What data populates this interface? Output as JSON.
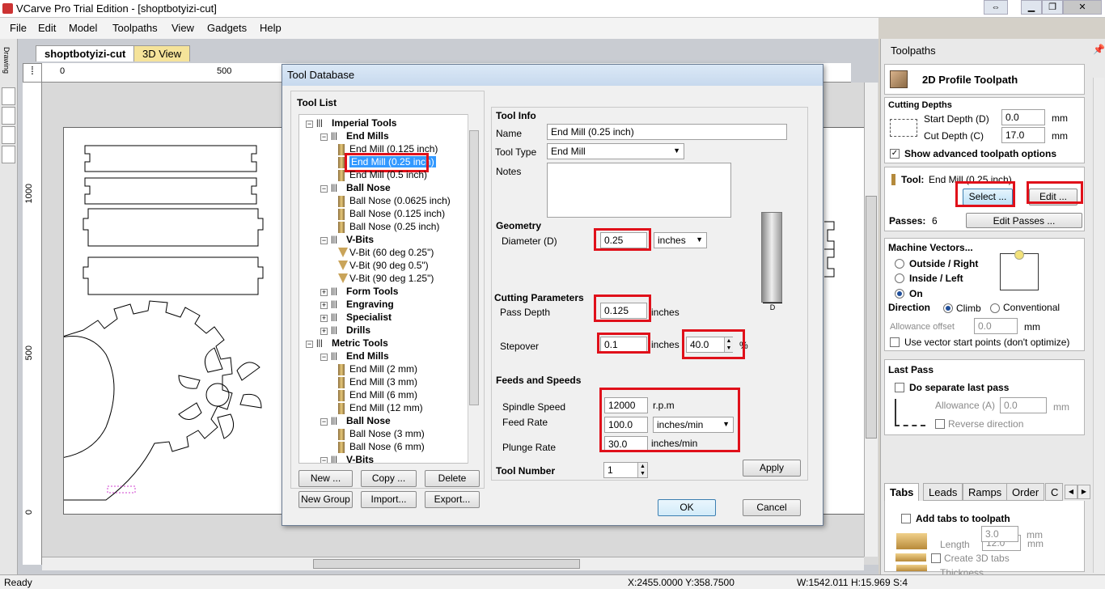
{
  "window": {
    "title": "VCarve Pro Trial Edition - [shoptbotyizi-cut]"
  },
  "menu": [
    "File",
    "Edit",
    "Model",
    "Toolpaths",
    "View",
    "Gadgets",
    "Help"
  ],
  "doc_tabs": {
    "active": "shoptbotyizi-cut",
    "other": "3D View"
  },
  "left_toolbar": {
    "label": "Drawing"
  },
  "rulers": {
    "h_ticks": [
      "0",
      "500"
    ],
    "v_ticks": [
      "1000",
      "500",
      "0"
    ]
  },
  "dialog": {
    "title": "Tool Database",
    "tool_list_label": "Tool List",
    "tree": [
      {
        "label": "Imperial Tools",
        "level": 0,
        "group": true,
        "sign": "−"
      },
      {
        "label": "End Mills",
        "level": 1,
        "group": true,
        "sign": "−"
      },
      {
        "label": "End Mill (0.125 inch)",
        "level": 2,
        "icon": "end-mill-icon"
      },
      {
        "label": "End Mill (0.25 inch)",
        "level": 2,
        "icon": "end-mill-icon",
        "selected": true
      },
      {
        "label": "End Mill (0.5 inch)",
        "level": 2,
        "icon": "end-mill-icon"
      },
      {
        "label": "Ball Nose",
        "level": 1,
        "group": true,
        "sign": "−"
      },
      {
        "label": "Ball Nose (0.0625 inch)",
        "level": 2,
        "icon": "ball-nose-icon"
      },
      {
        "label": "Ball Nose (0.125 inch)",
        "level": 2,
        "icon": "ball-nose-icon"
      },
      {
        "label": "Ball Nose (0.25 inch)",
        "level": 2,
        "icon": "ball-nose-icon"
      },
      {
        "label": "V-Bits",
        "level": 1,
        "group": true,
        "sign": "−"
      },
      {
        "label": "V-Bit (60 deg 0.25\")",
        "level": 2,
        "icon": "v-bit-icon"
      },
      {
        "label": "V-Bit (90 deg 0.5\")",
        "level": 2,
        "icon": "v-bit-icon"
      },
      {
        "label": "V-Bit (90 deg 1.25\")",
        "level": 2,
        "icon": "v-bit-icon"
      },
      {
        "label": "Form Tools",
        "level": 1,
        "group": true,
        "sign": "+"
      },
      {
        "label": "Engraving",
        "level": 1,
        "group": true,
        "sign": "+"
      },
      {
        "label": "Specialist",
        "level": 1,
        "group": true,
        "sign": "+"
      },
      {
        "label": "Drills",
        "level": 1,
        "group": true,
        "sign": "+"
      },
      {
        "label": "Metric Tools",
        "level": 0,
        "group": true,
        "sign": "−"
      },
      {
        "label": "End Mills",
        "level": 1,
        "group": true,
        "sign": "−"
      },
      {
        "label": "End Mill (2 mm)",
        "level": 2,
        "icon": "end-mill-icon"
      },
      {
        "label": "End Mill (3 mm)",
        "level": 2,
        "icon": "end-mill-icon"
      },
      {
        "label": "End Mill (6 mm)",
        "level": 2,
        "icon": "end-mill-icon"
      },
      {
        "label": "End Mill (12 mm)",
        "level": 2,
        "icon": "end-mill-icon"
      },
      {
        "label": "Ball Nose",
        "level": 1,
        "group": true,
        "sign": "−"
      },
      {
        "label": "Ball Nose (3 mm)",
        "level": 2,
        "icon": "ball-nose-icon"
      },
      {
        "label": "Ball Nose (6 mm)",
        "level": 2,
        "icon": "ball-nose-icon"
      },
      {
        "label": "V-Bits",
        "level": 1,
        "group": true,
        "sign": "−"
      }
    ],
    "buttons": {
      "new": "New ...",
      "copy": "Copy ...",
      "delete": "Delete",
      "new_group": "New Group",
      "import": "Import...",
      "export": "Export...",
      "apply": "Apply",
      "ok": "OK",
      "cancel": "Cancel"
    },
    "tool_info": {
      "heading": "Tool Info",
      "name_label": "Name",
      "name_value": "End Mill (0.25 inch)",
      "type_label": "Tool Type",
      "type_value": "End Mill",
      "notes_label": "Notes"
    },
    "geometry": {
      "heading": "Geometry",
      "diameter_label": "Diameter (D)",
      "diameter_value": "0.25",
      "units": "inches",
      "diagram_label": "D"
    },
    "cutting": {
      "heading": "Cutting Parameters",
      "pass_depth_label": "Pass Depth",
      "pass_depth_value": "0.125",
      "pass_depth_units": "inches",
      "stepover_label": "Stepover",
      "stepover_value": "0.1",
      "stepover_units": "inches",
      "stepover_pct": "40.0",
      "pct": "%"
    },
    "feeds": {
      "heading": "Feeds and Speeds",
      "spindle_label": "Spindle Speed",
      "spindle_value": "12000",
      "spindle_units": "r.p.m",
      "feed_label": "Feed Rate",
      "feed_value": "100.0",
      "feed_units": "inches/min",
      "plunge_label": "Plunge Rate",
      "plunge_value": "30.0",
      "plunge_units": "inches/min"
    },
    "tool_number": {
      "label": "Tool Number",
      "value": "1"
    }
  },
  "panel": {
    "header": "Toolpaths",
    "title": "2D Profile Toolpath",
    "cutting_depths": "Cutting Depths",
    "start_depth_label": "Start Depth (D)",
    "start_depth_value": "0.0",
    "cut_depth_label": "Cut Depth (C)",
    "cut_depth_value": "17.0",
    "mm": "mm",
    "show_advanced": "Show advanced toolpath options",
    "tool_label": "Tool:",
    "tool_value": "End Mill (0.25 inch)",
    "select_btn": "Select ...",
    "edit_btn": "Edit ...",
    "passes_label": "Passes:",
    "passes_value": "6",
    "edit_passes": "Edit Passes ...",
    "machine_vectors": "Machine Vectors...",
    "outside": "Outside / Right",
    "inside": "Inside / Left",
    "on": "On",
    "direction": "Direction",
    "climb": "Climb",
    "conventional": "Conventional",
    "allowance_label": "Allowance offset",
    "allowance_value": "0.0",
    "use_vector_start": "Use vector start points (don't optimize)",
    "last_pass": "Last Pass",
    "do_separate": "Do separate last pass",
    "allowance_a_label": "Allowance (A)",
    "allowance_a_value": "0.0",
    "reverse": "Reverse direction",
    "tabs": [
      "Tabs",
      "Leads",
      "Ramps",
      "Order",
      "C"
    ],
    "add_tabs": "Add tabs to toolpath",
    "length_label": "Length",
    "length_value": "12.0",
    "thickness_label": "Thickness",
    "thickness_value": "3.0",
    "create_3d": "Create 3D tabs"
  },
  "status": {
    "ready": "Ready",
    "coords": "X:2455.0000 Y:358.7500",
    "size": "W:1542.011  H:15.969  S:4"
  },
  "colors": {
    "highlight": "#e0101a",
    "selection": "#3399ff"
  }
}
